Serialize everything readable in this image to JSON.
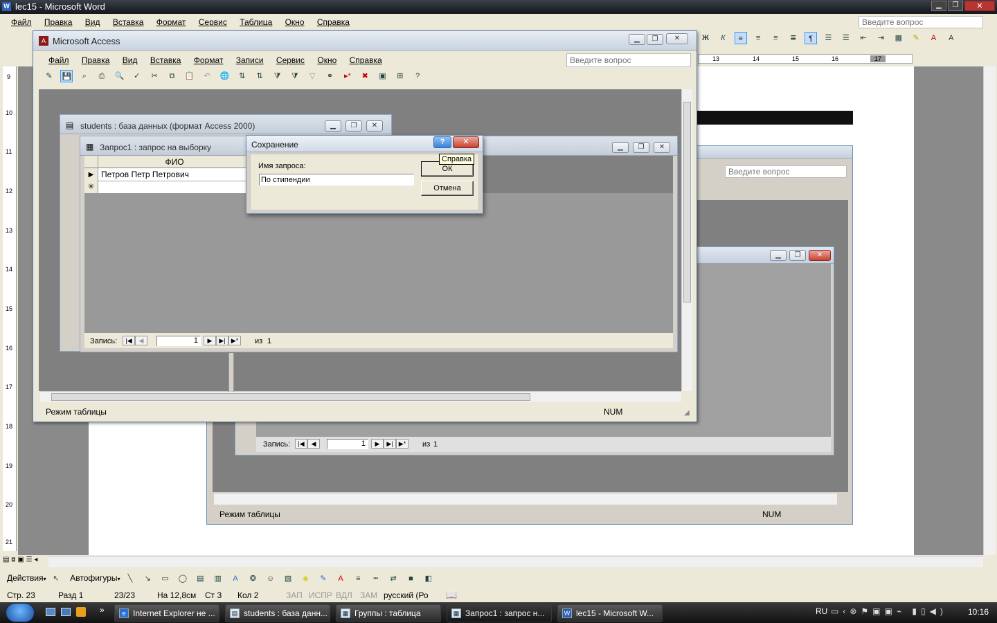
{
  "word": {
    "title": "lec15 - Microsoft Word",
    "menu": [
      "Файл",
      "Правка",
      "Вид",
      "Вставка",
      "Формат",
      "Сервис",
      "Таблица",
      "Окно",
      "Справка"
    ],
    "ask_placeholder": "Введите вопрос",
    "ruler_marks": [
      "13",
      "14",
      "15",
      "16",
      "17"
    ],
    "vruler_marks": [
      "9",
      "10",
      "11",
      "12",
      "13",
      "14",
      "15",
      "16",
      "17",
      "18",
      "19",
      "20",
      "21"
    ],
    "draw_bar": {
      "actions": "Действия",
      "autoshapes": "Автофигуры"
    },
    "status": {
      "page": "Стр. 23",
      "section": "Разд 1",
      "pages": "23/23",
      "at": "На 12,8см",
      "line": "Ст 3",
      "col": "Кол 2",
      "rec": "ЗАП",
      "trk": "ИСПР",
      "ext": "ВДЛ",
      "ovr": "ЗАМ",
      "lang": "русский (Ро"
    }
  },
  "access": {
    "title": "Microsoft Access",
    "menu": [
      "Файл",
      "Правка",
      "Вид",
      "Вставка",
      "Формат",
      "Записи",
      "Сервис",
      "Окно",
      "Справка"
    ],
    "ask_placeholder": "Введите вопрос",
    "status_left": "Режим таблицы",
    "status_right": "NUM"
  },
  "db_window": {
    "title": "students : база данных (формат Access 2000)"
  },
  "query_window": {
    "title": "Запрос1 : запрос на выборку",
    "column": "ФИО",
    "rows": [
      "Петров Петр Петрович"
    ],
    "record_label": "Запись:",
    "record_current": "1",
    "record_of": "из",
    "record_total": "1"
  },
  "dialog": {
    "title": "Сохранение",
    "label": "Имя запроса:",
    "value": "По стипендии",
    "ok": "ОК",
    "cancel": "Отмена",
    "tooltip": "Справка",
    "help_glyph": "?"
  },
  "background_access": {
    "ask_placeholder": "Введите вопрос",
    "record_label": "Запись:",
    "record_current": "1",
    "record_of": "из",
    "record_total": "1",
    "status_left": "Режим таблицы",
    "status_right": "NUM"
  },
  "taskbar": {
    "items": [
      "Internet Explorer не ...",
      "students : база данн...",
      "Группы : таблица",
      "Запрос1 : запрос н...",
      "lec15 - Microsoft W..."
    ],
    "lang": "RU",
    "clock": "10:16"
  },
  "colors": {
    "desktop_gray": "#808080",
    "taskbar": "#1f1f1f",
    "accent": "#3a6ea5"
  }
}
